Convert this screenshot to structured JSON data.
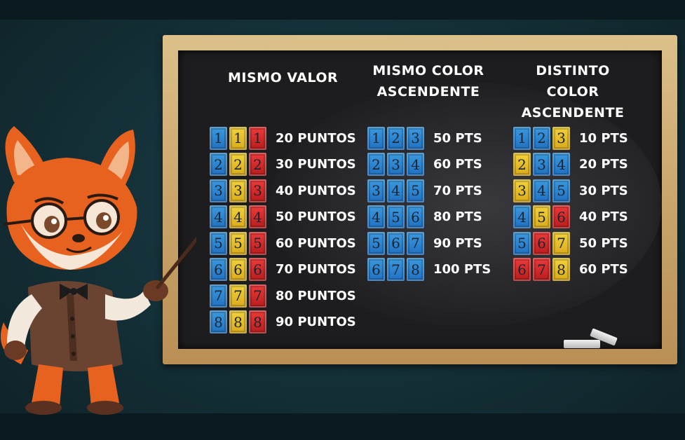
{
  "columns": [
    {
      "id": "same-value",
      "title_lines": [
        "MISMO VALOR"
      ],
      "rows": [
        {
          "tiles": [
            {
              "n": "1",
              "c": "blue"
            },
            {
              "n": "1",
              "c": "yellow"
            },
            {
              "n": "1",
              "c": "red"
            }
          ],
          "points": "20 PUNTOS"
        },
        {
          "tiles": [
            {
              "n": "2",
              "c": "blue"
            },
            {
              "n": "2",
              "c": "yellow"
            },
            {
              "n": "2",
              "c": "red"
            }
          ],
          "points": "30 PUNTOS"
        },
        {
          "tiles": [
            {
              "n": "3",
              "c": "blue"
            },
            {
              "n": "3",
              "c": "yellow"
            },
            {
              "n": "3",
              "c": "red"
            }
          ],
          "points": "40 PUNTOS"
        },
        {
          "tiles": [
            {
              "n": "4",
              "c": "blue"
            },
            {
              "n": "4",
              "c": "yellow"
            },
            {
              "n": "4",
              "c": "red"
            }
          ],
          "points": "50 PUNTOS"
        },
        {
          "tiles": [
            {
              "n": "5",
              "c": "blue"
            },
            {
              "n": "5",
              "c": "yellow"
            },
            {
              "n": "5",
              "c": "red"
            }
          ],
          "points": "60 PUNTOS"
        },
        {
          "tiles": [
            {
              "n": "6",
              "c": "blue"
            },
            {
              "n": "6",
              "c": "yellow"
            },
            {
              "n": "6",
              "c": "red"
            }
          ],
          "points": "70 PUNTOS"
        },
        {
          "tiles": [
            {
              "n": "7",
              "c": "blue"
            },
            {
              "n": "7",
              "c": "yellow"
            },
            {
              "n": "7",
              "c": "red"
            }
          ],
          "points": "80 PUNTOS"
        },
        {
          "tiles": [
            {
              "n": "8",
              "c": "blue"
            },
            {
              "n": "8",
              "c": "yellow"
            },
            {
              "n": "8",
              "c": "red"
            }
          ],
          "points": "90 PUNTOS"
        }
      ]
    },
    {
      "id": "same-color",
      "title_lines": [
        "MISMO COLOR",
        "ASCENDENTE"
      ],
      "rows": [
        {
          "tiles": [
            {
              "n": "1",
              "c": "blue"
            },
            {
              "n": "2",
              "c": "blue"
            },
            {
              "n": "3",
              "c": "blue"
            }
          ],
          "points": "50 PTS"
        },
        {
          "tiles": [
            {
              "n": "2",
              "c": "blue"
            },
            {
              "n": "3",
              "c": "blue"
            },
            {
              "n": "4",
              "c": "blue"
            }
          ],
          "points": "60 PTS"
        },
        {
          "tiles": [
            {
              "n": "3",
              "c": "blue"
            },
            {
              "n": "4",
              "c": "blue"
            },
            {
              "n": "5",
              "c": "blue"
            }
          ],
          "points": "70 PTS"
        },
        {
          "tiles": [
            {
              "n": "4",
              "c": "blue"
            },
            {
              "n": "5",
              "c": "blue"
            },
            {
              "n": "6",
              "c": "blue"
            }
          ],
          "points": "80 PTS"
        },
        {
          "tiles": [
            {
              "n": "5",
              "c": "blue"
            },
            {
              "n": "6",
              "c": "blue"
            },
            {
              "n": "7",
              "c": "blue"
            }
          ],
          "points": "90 PTS"
        },
        {
          "tiles": [
            {
              "n": "6",
              "c": "blue"
            },
            {
              "n": "7",
              "c": "blue"
            },
            {
              "n": "8",
              "c": "blue"
            }
          ],
          "points": "100 PTS"
        }
      ]
    },
    {
      "id": "different-color",
      "title_lines": [
        "DISTINTO COLOR",
        "ASCENDENTE"
      ],
      "rows": [
        {
          "tiles": [
            {
              "n": "1",
              "c": "blue"
            },
            {
              "n": "2",
              "c": "blue"
            },
            {
              "n": "3",
              "c": "yellow"
            }
          ],
          "points": "10 PTS"
        },
        {
          "tiles": [
            {
              "n": "2",
              "c": "yellow"
            },
            {
              "n": "3",
              "c": "blue"
            },
            {
              "n": "4",
              "c": "blue"
            }
          ],
          "points": "20 PTS"
        },
        {
          "tiles": [
            {
              "n": "3",
              "c": "yellow"
            },
            {
              "n": "4",
              "c": "blue"
            },
            {
              "n": "5",
              "c": "blue"
            }
          ],
          "points": "30 PTS"
        },
        {
          "tiles": [
            {
              "n": "4",
              "c": "blue"
            },
            {
              "n": "5",
              "c": "yellow"
            },
            {
              "n": "6",
              "c": "red"
            }
          ],
          "points": "40 PTS"
        },
        {
          "tiles": [
            {
              "n": "5",
              "c": "blue"
            },
            {
              "n": "6",
              "c": "red"
            },
            {
              "n": "7",
              "c": "yellow"
            }
          ],
          "points": "50 PTS"
        },
        {
          "tiles": [
            {
              "n": "6",
              "c": "red"
            },
            {
              "n": "7",
              "c": "red"
            },
            {
              "n": "8",
              "c": "yellow"
            }
          ],
          "points": "60 PTS"
        }
      ]
    }
  ],
  "colors": {
    "blue": "#2a84d2",
    "yellow": "#e8bf2a",
    "red": "#d42a2a",
    "board": "#1d1d1f",
    "frame": "#cda86c",
    "background": "#15323a"
  },
  "icons": [
    "fox-teacher-icon",
    "pointer-stick-icon",
    "chalk-icon"
  ]
}
